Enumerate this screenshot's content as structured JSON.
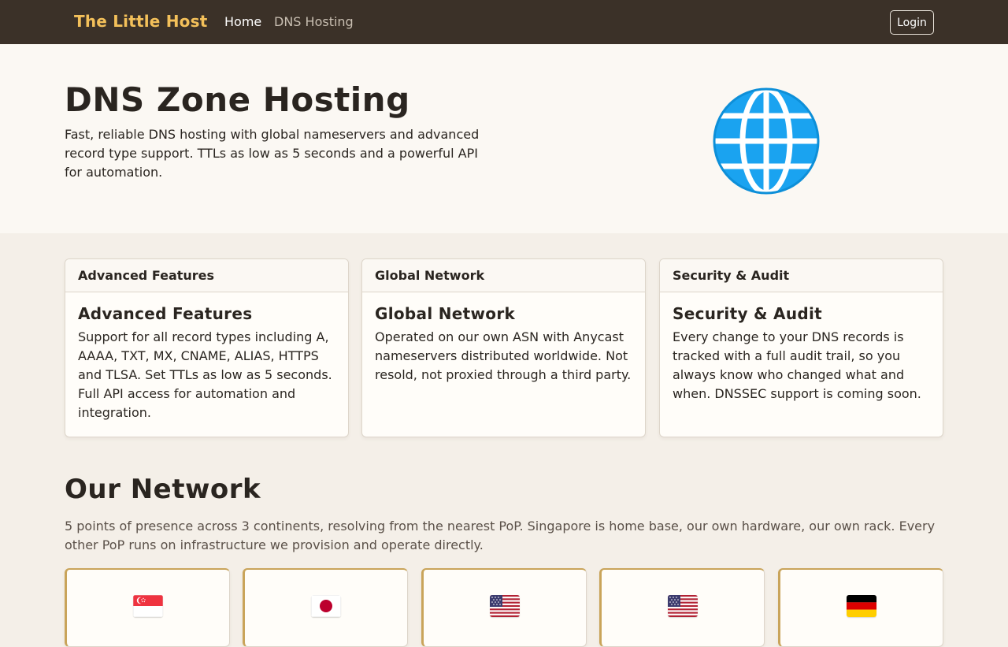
{
  "navbar": {
    "brand": "The Little Host",
    "links": [
      {
        "label": "Home",
        "active": true
      },
      {
        "label": "DNS Hosting",
        "active": false
      }
    ],
    "login_label": "Login"
  },
  "hero": {
    "title": "DNS Zone Hosting",
    "description": "Fast, reliable DNS hosting with global nameservers and advanced record type support. TTLs as low as 5 seconds and a powerful API for automation.",
    "icon": "globe-icon"
  },
  "features": [
    {
      "header": "Advanced Features",
      "title": "Advanced Features",
      "body": "Support for all record types including A, AAAA, TXT, MX, CNAME, ALIAS, HTTPS and TLSA. Set TTLs as low as 5 seconds. Full API access for automation and integration."
    },
    {
      "header": "Global Network",
      "title": "Global Network",
      "body": "Operated on our own ASN with Anycast nameservers distributed worldwide. Not resold, not proxied through a third party."
    },
    {
      "header": "Security & Audit",
      "title": "Security & Audit",
      "body": "Every change to your DNS records is tracked with a full audit trail, so you always know who changed what and when. DNSSEC support is coming soon."
    }
  ],
  "network": {
    "title": "Our Network",
    "description": "5 points of presence across 3 continents, resolving from the nearest PoP. Singapore is home base, our own hardware, our own rack. Every other PoP runs on infrastructure we provision and operate directly.",
    "pops": [
      {
        "flag": "singapore-flag-icon"
      },
      {
        "flag": "japan-flag-icon"
      },
      {
        "flag": "usa-flag-icon"
      },
      {
        "flag": "usa-flag-icon"
      },
      {
        "flag": "germany-flag-icon"
      }
    ]
  },
  "colors": {
    "navbar_bg": "#3b3128",
    "brand": "#f3c05a",
    "hero_bg": "#fbf8f3",
    "page_bg": "#f4efe8",
    "accent_gold": "#c9a45a",
    "globe_blue": "#1aa3f0"
  }
}
